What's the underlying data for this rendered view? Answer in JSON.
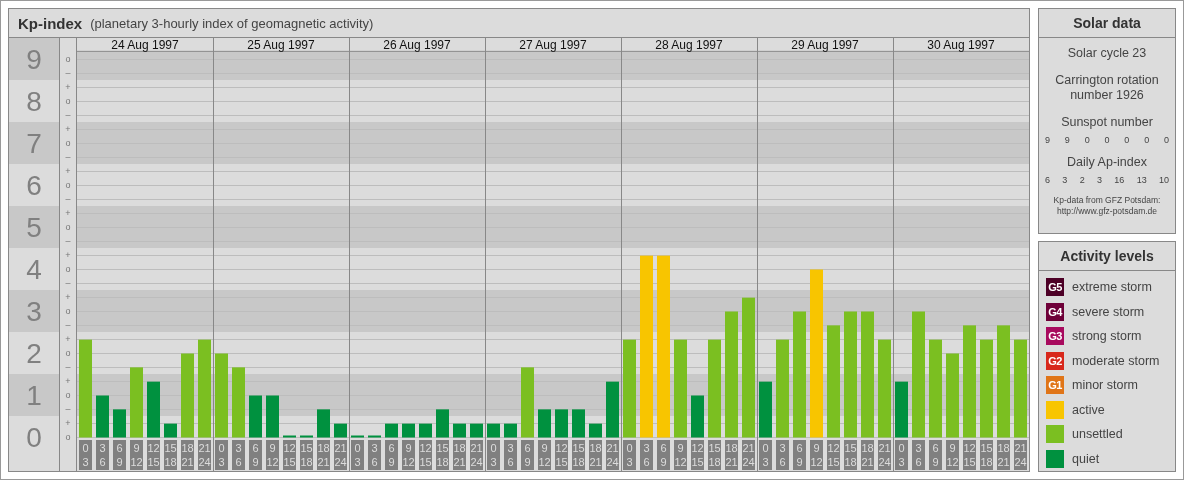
{
  "kp_panel": {
    "title": "Kp-index",
    "subtitle": "(planetary 3-hourly index of geomagnetic activity)",
    "days": [
      "24 Aug 1997",
      "25 Aug 1997",
      "26 Aug 1997",
      "27 Aug 1997",
      "28 Aug 1997",
      "29 Aug 1997",
      "30 Aug 1997"
    ],
    "minor_ticks": [
      "o",
      "–",
      "+",
      "o",
      "–",
      "+",
      "o",
      "–",
      "+",
      "o",
      "–",
      "+",
      "o",
      "–",
      "+",
      "o",
      "–",
      "+",
      "o",
      "–",
      "+",
      "o",
      "–",
      "+",
      "o",
      "–",
      "+",
      "o"
    ],
    "chart_data": {
      "type": "bar",
      "stacked": true,
      "categories": [
        "0 3",
        "3 6",
        "6 9",
        "9 12",
        "12 15",
        "15 18",
        "18 21",
        "21 24",
        "0 3",
        "3 6",
        "6 9",
        "9 12",
        "12 15",
        "15 18",
        "18 21",
        "21 24",
        "0 3",
        "3 6",
        "6 9",
        "9 12",
        "12 15",
        "15 18",
        "18 21",
        "21 24",
        "0 3",
        "3 6",
        "6 9",
        "9 12",
        "12 15",
        "15 18",
        "18 21",
        "21 24",
        "0 3",
        "3 6",
        "6 9",
        "9 12",
        "12 15",
        "15 18",
        "18 21",
        "21 24",
        "0 3",
        "3 6",
        "6 9",
        "9 12",
        "12 15",
        "15 18",
        "18 21",
        "21 24",
        "0 3",
        "3 6",
        "6 9",
        "9 12",
        "12 15",
        "15 18",
        "18 21",
        "21 24"
      ],
      "ylim": [
        0,
        9.17
      ],
      "yticks": [
        0,
        1,
        2,
        3,
        4,
        5,
        6,
        7,
        8,
        9
      ],
      "grid": true,
      "series": [
        {
          "color": "#00913f",
          "values": [
            null,
            1,
            0.67,
            null,
            1.33,
            0.33,
            null,
            null,
            null,
            null,
            1,
            1,
            0,
            0,
            0.67,
            0.33,
            0,
            0,
            0.33,
            0.33,
            0.33,
            0.67,
            0.33,
            0.33,
            0.33,
            0.33,
            null,
            0.67,
            0.67,
            0.67,
            0.33,
            1.33,
            null,
            null,
            null,
            null,
            1,
            null,
            null,
            null,
            1.33,
            null,
            null,
            null,
            null,
            null,
            null,
            null,
            1.33,
            null,
            null,
            null,
            null,
            null,
            null,
            null
          ]
        },
        {
          "color": "#7bbf21",
          "values": [
            2.33,
            null,
            null,
            1.67,
            null,
            null,
            2,
            2.33,
            2,
            1.67,
            null,
            null,
            null,
            null,
            null,
            null,
            null,
            null,
            null,
            null,
            null,
            null,
            null,
            null,
            null,
            null,
            1.67,
            null,
            null,
            null,
            null,
            null,
            2.33,
            null,
            null,
            2.33,
            null,
            2.33,
            3,
            3.33,
            null,
            2.33,
            3,
            null,
            2.67,
            3,
            3,
            2.33,
            null,
            3,
            2.33,
            2,
            2.67,
            2.33,
            2.67,
            2.33
          ]
        },
        {
          "color": "#f8c500",
          "values": [
            null,
            null,
            null,
            null,
            null,
            null,
            null,
            null,
            null,
            null,
            null,
            null,
            null,
            null,
            null,
            null,
            null,
            null,
            null,
            null,
            null,
            null,
            null,
            null,
            null,
            null,
            null,
            null,
            null,
            null,
            null,
            null,
            null,
            4.33,
            4.33,
            null,
            null,
            null,
            null,
            null,
            null,
            null,
            null,
            4,
            null,
            null,
            null,
            null,
            null,
            null,
            null,
            null,
            null,
            null,
            null,
            null
          ]
        }
      ]
    }
  },
  "solar_data": {
    "title": "Solar data",
    "solar_cycle": "Solar cycle 23",
    "carrington": "Carrington rotation number 1926",
    "sunspot_title": "Sunspot number",
    "sunspot_numbers": [
      "9",
      "9",
      "0",
      "0",
      "0",
      "0",
      "0"
    ],
    "ap_title": "Daily Ap-index",
    "ap_values": [
      "6",
      "3",
      "2",
      "3",
      "16",
      "13",
      "10"
    ],
    "source": "Kp-data from GFZ Potsdam:",
    "source_url": "http://www.gfz-potsdam.de"
  },
  "legend": {
    "title": "Activity levels",
    "items": [
      {
        "code": "G5",
        "label": "extreme storm",
        "color": "#4d0026"
      },
      {
        "code": "G4",
        "label": "severe storm",
        "color": "#6e0038"
      },
      {
        "code": "G3",
        "label": "strong storm",
        "color": "#a80a5e"
      },
      {
        "code": "G2",
        "label": "moderate storm",
        "color": "#d8281c"
      },
      {
        "code": "G1",
        "label": "minor storm",
        "color": "#e07518"
      },
      {
        "label": "active",
        "color": "#f8c500"
      },
      {
        "label": "unsettled",
        "color": "#7bbf21"
      },
      {
        "label": "quiet",
        "color": "#00913f"
      }
    ]
  }
}
